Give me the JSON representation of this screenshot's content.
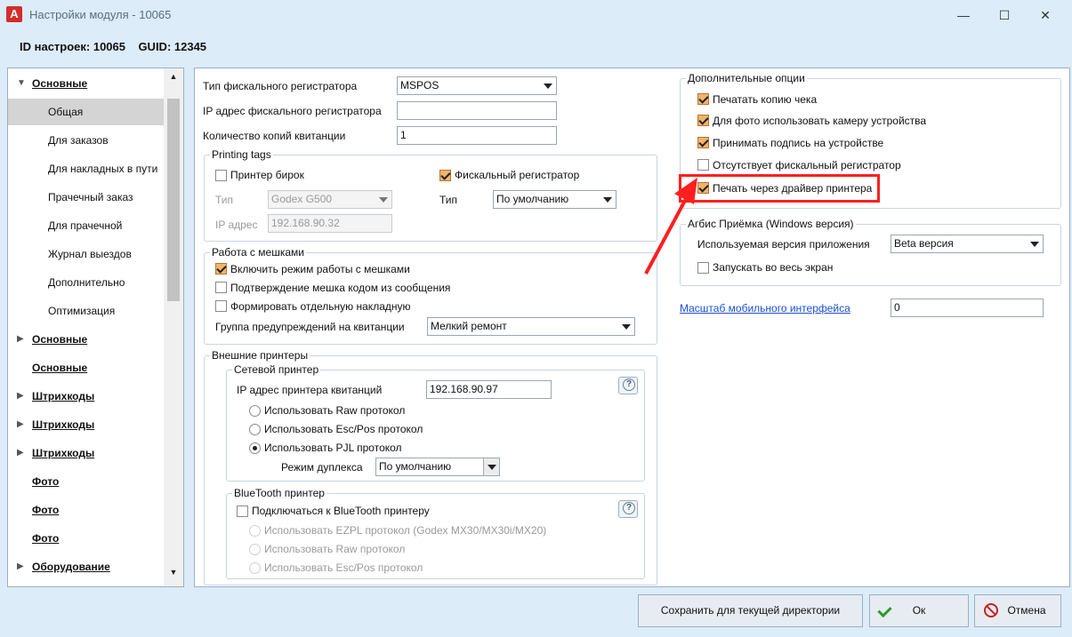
{
  "window": {
    "title": "Настройки модуля - 10065",
    "logo": "A"
  },
  "header": {
    "id_line": "ID настроек: 10065    GUID: 12345"
  },
  "sidebar": {
    "items": [
      {
        "label": "Основные",
        "group": true,
        "arrow": "▼"
      },
      {
        "label": "Общая",
        "selected": true
      },
      {
        "label": "Для заказов"
      },
      {
        "label": "Для накладных в пути"
      },
      {
        "label": "Прачечный заказ"
      },
      {
        "label": "Для прачечной"
      },
      {
        "label": "Журнал выездов"
      },
      {
        "label": "Дополнительно"
      },
      {
        "label": "Оптимизация"
      },
      {
        "label": "Основные",
        "group": true,
        "arrow": "▶"
      },
      {
        "label": "Основные",
        "group": true,
        "arrow": ""
      },
      {
        "label": "Штрихкоды",
        "group": true,
        "arrow": "▶"
      },
      {
        "label": "Штрихкоды",
        "group": true,
        "arrow": "▶"
      },
      {
        "label": "Штрихкоды",
        "group": true,
        "arrow": "▶"
      },
      {
        "label": "Фото",
        "group": true,
        "arrow": ""
      },
      {
        "label": "Фото",
        "group": true,
        "arrow": ""
      },
      {
        "label": "Фото",
        "group": true,
        "arrow": ""
      },
      {
        "label": "Оборудование",
        "group": true,
        "arrow": "▶"
      }
    ]
  },
  "main": {
    "fiscal_type_label": "Тип фискального регистратора",
    "fiscal_type_value": "MSPOS",
    "fiscal_ip_label": "IP адрес фискального регистратора",
    "fiscal_ip_value": "",
    "copies_label": "Количество копий квитанции",
    "copies_value": "1",
    "printing_tags": {
      "title": "Printing tags",
      "tag_printer_label": "Принтер бирок",
      "tag_printer_checked": false,
      "fiscal_reg_label": "Фискальный регистратор",
      "fiscal_reg_checked": true,
      "type_label": "Тип",
      "type_value": "Godex G500",
      "ip_label": "IP адрес",
      "ip_value": "192.168.90.32",
      "type2_label": "Тип",
      "type2_value": "По умолчанию"
    },
    "bags": {
      "title": "Работа с мешками",
      "enable_label": "Включить режим работы с мешками",
      "enable_checked": true,
      "confirm_label": "Подтверждение мешка кодом из сообщения",
      "confirm_checked": false,
      "separate_label": "Формировать отдельную накладную",
      "separate_checked": false,
      "warn_group_label": "Группа предупреждений на квитанции",
      "warn_group_value": "Мелкий ремонт"
    },
    "external": {
      "title": "Внешние принтеры",
      "network": {
        "title": "Сетевой принтер",
        "ip_label": "IP адрес принтера квитанций",
        "ip_value": "192.168.90.97",
        "raw_label": "Использовать Raw протокол",
        "escpos_label": "Использовать Esc/Pos протокол",
        "pjl_label": "Использовать PJL протокол",
        "duplex_label": "Режим дуплекса",
        "duplex_value": "По умолчанию"
      },
      "bluetooth": {
        "title": "BlueTooth принтер",
        "connect_label": "Подключаться к BlueTooth принтеру",
        "ezpl_label": "Использовать EZPL протокол (Godex MX30/MX30i/MX20)",
        "raw_label": "Использовать Raw протокол",
        "escpos_label": "Использовать Esc/Pos протокол"
      }
    },
    "extra": {
      "title": "Дополнительные опции",
      "opt1": "Печатать копию чека",
      "opt2": "Для фото использовать камеру устройства",
      "opt3": "Принимать подпись на устройстве",
      "opt4": "Отсутствует фискальный регистратор",
      "opt5": "Печать через драйвер принтера"
    },
    "agbis": {
      "title": "Агбис Приёмка (Windows версия)",
      "version_label": "Используемая версия приложения",
      "version_value": "Beta версия",
      "fullscreen_label": "Запускать во весь экран"
    },
    "scale_link": "Масштаб мобильного интерфейса",
    "scale_value": "0"
  },
  "footer": {
    "save_dir_label": "Сохранить для текущей директории",
    "ok_label": "Ок",
    "cancel_label": "Отмена"
  },
  "colors": {
    "accent": "#ff1f1f",
    "check": "#f4b36a",
    "link": "#1a4fd6"
  }
}
